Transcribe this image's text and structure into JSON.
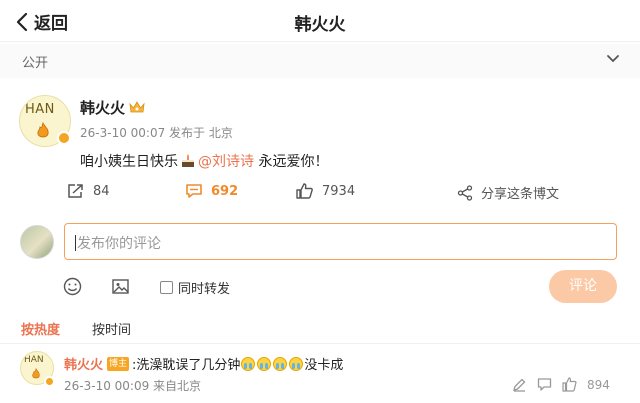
{
  "header": {
    "back_label": "返回",
    "title": "韩火火"
  },
  "scope": {
    "label": "公开"
  },
  "post": {
    "author": "韩火火",
    "avatar_text": "HAN",
    "meta": "26-3-10 00:07 发布于 北京",
    "text_before": "咱小姨生日快乐",
    "mention": "@刘诗诗",
    "text_after": " 永远爱你！",
    "actions": {
      "repost_count": "84",
      "comment_count": "692",
      "like_count": "7934",
      "share_label": "分享这条博文"
    }
  },
  "composer": {
    "placeholder": "发布你的评论",
    "repost_label": "同时转发",
    "submit_label": "评论"
  },
  "sort": {
    "hot_label": "按热度",
    "time_label": "按时间"
  },
  "comments": [
    {
      "author": "韩火火",
      "avatar_text": "HAN",
      "tag": "博主",
      "text_before": ":洗澡耽误了几分钟",
      "text_after": "没卡成",
      "meta": "26-3-10 00:09 来自北京",
      "like_count": "894"
    }
  ],
  "colors": {
    "accent": "#eb7350",
    "hot": "#f08a2b",
    "submit_disabled": "#fbc9a5",
    "input_border": "#f4a25b"
  },
  "icons": [
    "chevron-left-icon",
    "chevron-down-icon",
    "crown-icon",
    "verified-badge-icon",
    "cake-icon",
    "repost-icon",
    "comment-icon",
    "like-icon",
    "share-icon",
    "emoji-icon",
    "image-icon",
    "crying-emoji-icon",
    "edit-icon",
    "reply-icon",
    "like-small-icon"
  ]
}
